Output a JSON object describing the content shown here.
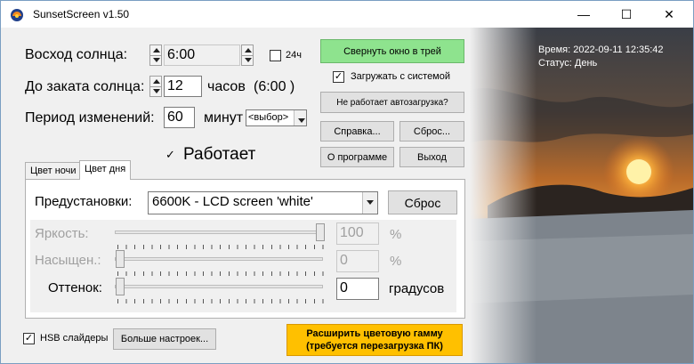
{
  "window": {
    "title": "SunsetScreen v1.50",
    "min_glyph": "—",
    "max_glyph": "☐",
    "close_glyph": "✕"
  },
  "sunrise": {
    "label": "Восход солнца:",
    "value": "6:00",
    "h24_label": "24ч"
  },
  "sunset": {
    "label": "До заката солнца:",
    "value": "12",
    "unit": "часов",
    "computed": "(6:00 )"
  },
  "period": {
    "label": "Период изменений:",
    "value": "60",
    "unit": "минут",
    "select": "<выбор>"
  },
  "status_toggle": {
    "label": "Работает",
    "checked": true
  },
  "buttons": {
    "minimize_tray": "Свернуть окно в трей",
    "autostart_broken": "Не работает автозагрузка?",
    "help": "Справка...",
    "reset_top": "Сброс...",
    "about": "О программе",
    "exit": "Выход",
    "reset_presets": "Сброс",
    "more_settings": "Больше настроек...",
    "expand_gamma_line1": "Расширить цветовую гамму",
    "expand_gamma_line2": "(требуется перезагрузка ПК)"
  },
  "startup": {
    "label": "Загружать с системой",
    "checked": true
  },
  "tabs": [
    {
      "label": "Цвет ночи",
      "active": false
    },
    {
      "label": "Цвет дня",
      "active": true
    }
  ],
  "presets": {
    "label": "Предустановки:",
    "value": "6600K - LCD screen 'white'"
  },
  "sliders": [
    {
      "label": "Яркость:",
      "value": "100",
      "unit": "%",
      "level": 1.0,
      "enabled": false
    },
    {
      "label": "Насыщен.:",
      "value": "0",
      "unit": "%",
      "level": 0.0,
      "enabled": false
    },
    {
      "label": "Оттенок:",
      "value": "0",
      "unit": "градусов",
      "level": 0.0,
      "enabled": true
    }
  ],
  "hsb": {
    "label": "HSB слайдеры",
    "checked": true
  },
  "info": {
    "time": "Время: 2022-09-11 12:35:42",
    "status": "Статус: День"
  },
  "colors": {
    "green_button": "#8ee38e",
    "orange_button": "#ffc000"
  }
}
